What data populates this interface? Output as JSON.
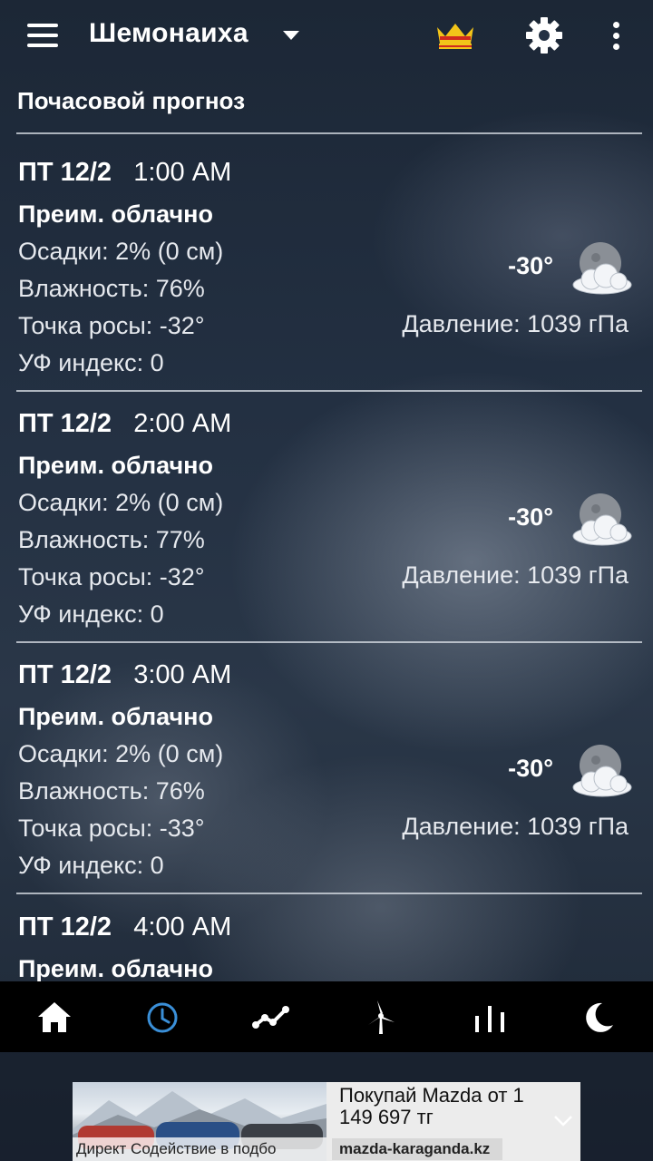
{
  "header": {
    "city": "Шемонаиха",
    "icons": [
      "menu-icon",
      "chevron-down-icon",
      "crown-icon",
      "gear-icon",
      "more-vert-icon"
    ]
  },
  "section_title": "Почасовой прогноз",
  "hours": [
    {
      "day": "ПТ 12/2",
      "time": "1:00 AM",
      "condition": "Преим. облачно",
      "precip": "Осадки: 2% (0 см)",
      "humidity": "Влажность: 76%",
      "dew": "Точка росы: -32°",
      "uv": "УФ индекс: 0",
      "temp": "-30°",
      "pressure": "Давление: 1039 гПа",
      "icon": "night-cloudy-icon"
    },
    {
      "day": "ПТ 12/2",
      "time": "2:00 AM",
      "condition": "Преим. облачно",
      "precip": "Осадки: 2% (0 см)",
      "humidity": "Влажность: 77%",
      "dew": "Точка росы: -32°",
      "uv": "УФ индекс: 0",
      "temp": "-30°",
      "pressure": "Давление: 1039 гПа",
      "icon": "night-cloudy-icon"
    },
    {
      "day": "ПТ 12/2",
      "time": "3:00 AM",
      "condition": "Преим. облачно",
      "precip": "Осадки: 2% (0 см)",
      "humidity": "Влажность: 76%",
      "dew": "Точка росы: -33°",
      "uv": "УФ индекс: 0",
      "temp": "-30°",
      "pressure": "Давление: 1039 гПа",
      "icon": "night-cloudy-icon"
    },
    {
      "day": "ПТ 12/2",
      "time": "4:00 AM",
      "condition": "Преим. облачно"
    }
  ],
  "bottom_nav": [
    {
      "icon": "home-icon",
      "active": false
    },
    {
      "icon": "clock-icon",
      "active": true
    },
    {
      "icon": "trend-chart-icon",
      "active": false
    },
    {
      "icon": "wind-turbine-icon",
      "active": false
    },
    {
      "icon": "bar-chart-icon",
      "active": false
    },
    {
      "icon": "moon-icon",
      "active": false
    }
  ],
  "ad": {
    "caption": "Директ  Содействие в подбо",
    "headline": "Покупай Mazda от 1 149 697 тг",
    "domain": "mazda-karaganda.kz"
  },
  "colors": {
    "active_nav": "#3a8fd8",
    "crown_gold": "#f2c419",
    "crown_red": "#d12a1e",
    "nav_background": "#000000"
  }
}
